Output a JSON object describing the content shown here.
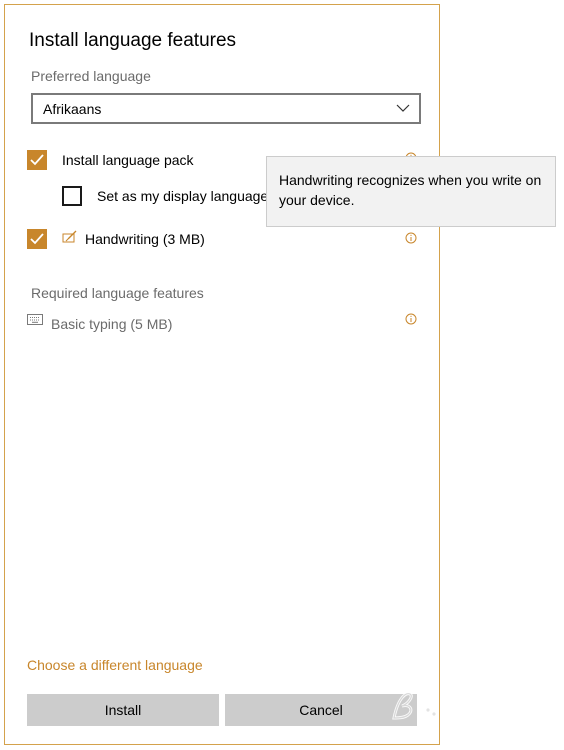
{
  "dialog": {
    "title": "Install language features",
    "preferred_label": "Preferred language",
    "selected_language": "Afrikaans",
    "options": [
      {
        "label": "Install language pack",
        "checked": true
      },
      {
        "label": "Set as my display language",
        "checked": false
      },
      {
        "label": "Handwriting (3 MB)",
        "checked": true,
        "icon": "handwriting-pen-icon"
      }
    ],
    "required_label": "Required language features",
    "required_items": [
      {
        "label": "Basic typing (5 MB)",
        "icon": "keyboard-icon"
      }
    ],
    "change_link": "Choose a different language",
    "install_button": "Install",
    "cancel_button": "Cancel"
  },
  "tooltip": {
    "text": "Handwriting recognizes when you write on your device."
  },
  "colors": {
    "accent": "#c8862b",
    "border": "#d4a24c",
    "button_bg": "#cccccc",
    "tooltip_bg": "#f2f2f2",
    "muted_text": "#6b6b6b"
  }
}
